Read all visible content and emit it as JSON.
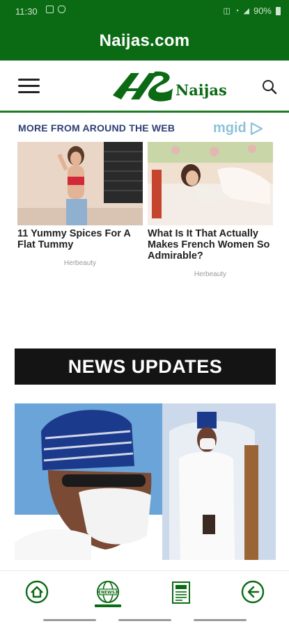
{
  "status_bar": {
    "time": "11:30",
    "battery": "90%"
  },
  "app": {
    "title": "Naijas.com"
  },
  "site_header": {
    "logo_text": "Naijas"
  },
  "ads": {
    "heading": "MORE FROM AROUND THE WEB",
    "provider": "mgid",
    "items": [
      {
        "title": "11 Yummy Spices For A Flat Tummy",
        "source": "Herbeauty"
      },
      {
        "title": "What Is It That Actually Makes French Women So Admirable?",
        "source": "Herbeauty"
      }
    ]
  },
  "news": {
    "heading": "NEWS UPDATES"
  },
  "colors": {
    "brand_green": "#0b6b14",
    "banner_black": "#141414"
  }
}
